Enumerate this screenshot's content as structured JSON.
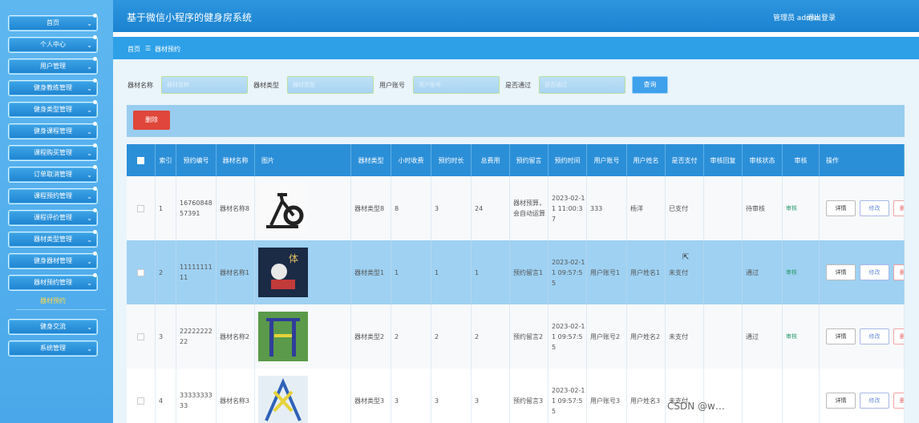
{
  "app": {
    "title": "基于微信小程序的健身房系统",
    "admin": "管理员 admin",
    "logout": "退出登录"
  },
  "sidebar": {
    "items": [
      "首页",
      "个人中心",
      "用户管理",
      "健身教练管理",
      "健身类型管理",
      "健身课程管理",
      "课程购买管理",
      "订单取消管理",
      "课程预约管理",
      "课程评价管理",
      "器材类型管理",
      "健身器材管理",
      "器材预约管理"
    ],
    "sub_item": "器材预约",
    "items_after": [
      "健身交流",
      "系统管理"
    ]
  },
  "breadcrumb": {
    "home": "首页",
    "sep": "☰",
    "current": "器材预约"
  },
  "search": {
    "fields": [
      {
        "label": "器材名称",
        "placeholder": "器材名称"
      },
      {
        "label": "器材类型",
        "placeholder": "器材类型"
      },
      {
        "label": "用户账号",
        "placeholder": "用户账号"
      },
      {
        "label": "是否通过",
        "placeholder": "是否通过"
      }
    ],
    "query_label": "查询"
  },
  "actions": {
    "delete_label": "删除"
  },
  "table": {
    "headers": [
      "",
      "索引",
      "预约编号",
      "器材名称",
      "图片",
      "器材类型",
      "小时收费",
      "预约时长",
      "总费用",
      "预约留言",
      "预约时间",
      "用户账号",
      "用户姓名",
      "是否支付",
      "审核回复",
      "审核状态",
      "审核",
      "操作"
    ],
    "rows": [
      {
        "index": "1",
        "no": "1676084857391",
        "name": "器材名称8",
        "type": "器材类型8",
        "rate": "8",
        "hours": "3",
        "total": "24",
        "msg": "器材预算，会自动运算",
        "time": "2023-02-11 11:00:37",
        "account": "333",
        "user": "杨洋",
        "paid": "已支付",
        "reply": "",
        "status": "待审核",
        "audit": "审核",
        "img": "bike"
      },
      {
        "index": "2",
        "no": "1111111111",
        "name": "器材名称1",
        "type": "器材类型1",
        "rate": "1",
        "hours": "1",
        "total": "1",
        "msg": "预约留言1",
        "time": "2023-02-11 09:57:55",
        "account": "用户账号1",
        "user": "用户姓名1",
        "paid": "未支付",
        "reply": "",
        "status": "通过",
        "audit": "审核",
        "img": "poster"
      },
      {
        "index": "3",
        "no": "2222222222",
        "name": "器材名称2",
        "type": "器材类型2",
        "rate": "2",
        "hours": "2",
        "total": "2",
        "msg": "预约留言2",
        "time": "2023-02-11 09:57:55",
        "account": "用户账号2",
        "user": "用户姓名2",
        "paid": "未支付",
        "reply": "",
        "status": "通过",
        "audit": "审核",
        "img": "bars"
      },
      {
        "index": "4",
        "no": "3333333333",
        "name": "器材名称3",
        "type": "器材类型3",
        "rate": "3",
        "hours": "3",
        "total": "3",
        "msg": "预约留言3",
        "time": "2023-02-11 09:57:55",
        "account": "用户账号3",
        "user": "用户姓名3",
        "paid": "未支付",
        "reply": "",
        "status": "",
        "audit": "",
        "img": "walker"
      }
    ],
    "op_labels": {
      "detail": "详情",
      "edit": "修改",
      "delete": "删除"
    }
  },
  "watermark": "CSDN @w…"
}
